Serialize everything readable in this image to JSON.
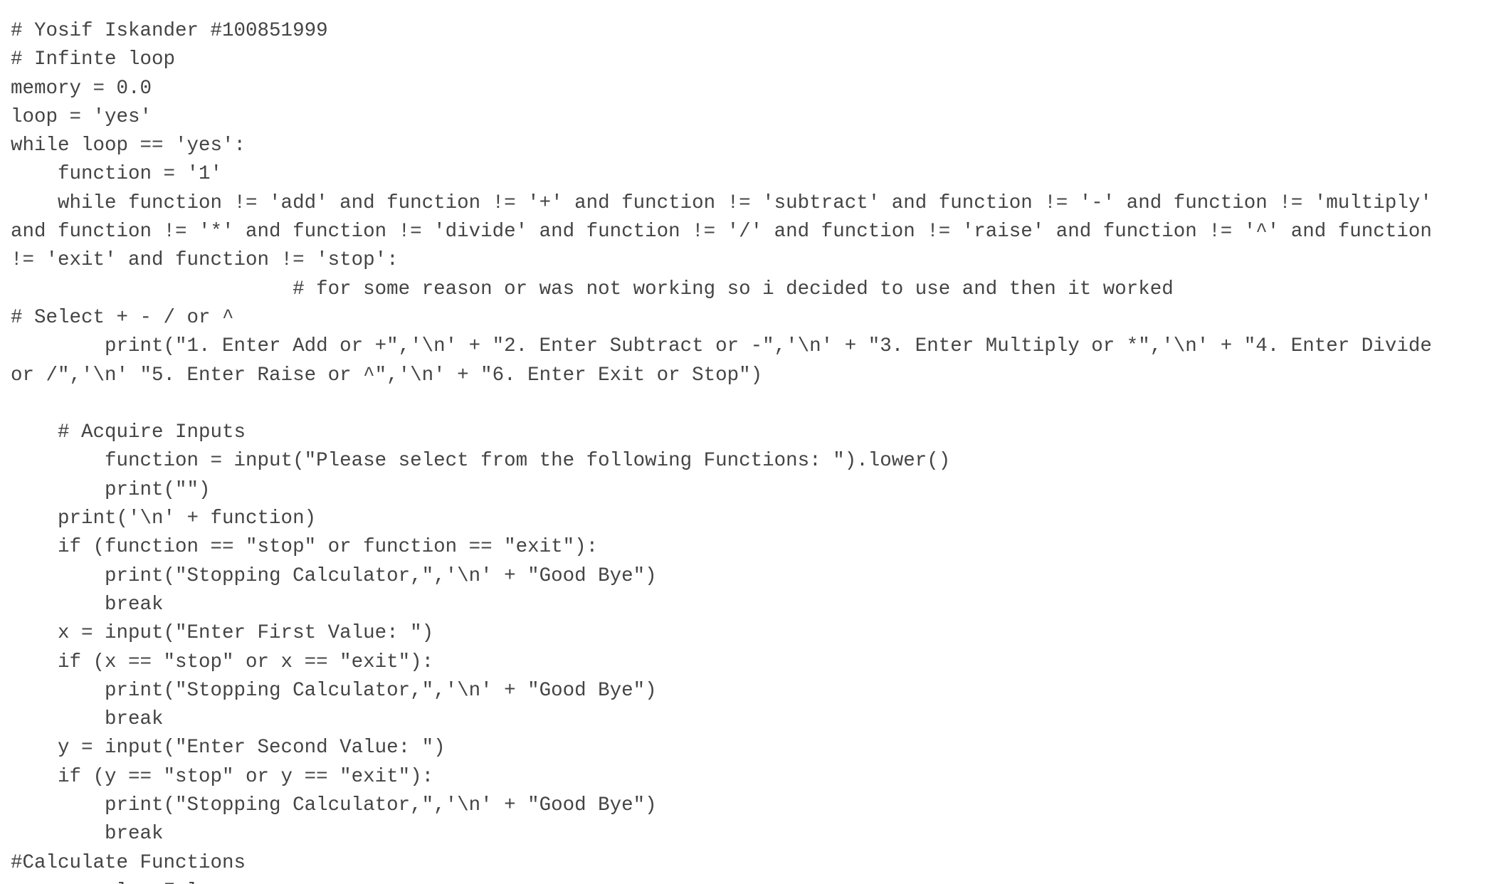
{
  "document": {
    "lines": [
      {
        "name": "comment-author",
        "text": "# Yosif Iskander #100851999"
      },
      {
        "name": "comment-infinite-loop",
        "text": "# Infinte loop"
      },
      {
        "name": "code-memory-init",
        "text": "memory = 0.0"
      },
      {
        "name": "code-loop-init",
        "text": "loop = 'yes'"
      },
      {
        "name": "code-while-loop",
        "text": "while loop == 'yes':"
      },
      {
        "name": "code-function-init",
        "text": "    function = '1'"
      },
      {
        "name": "code-while-function",
        "text": "    while function != 'add' and function != '+' and function != 'subtract' and function != '-' and function != 'multiply'"
      },
      {
        "name": "code-while-function-cont-1",
        "text": "and function != '*' and function != 'divide' and function != '/' and function != 'raise' and function != '^' and function"
      },
      {
        "name": "code-while-function-cont-2",
        "text": "!= 'exit' and function != 'stop':"
      },
      {
        "name": "comment-reason",
        "text": "                        # for some reason or was not working so i decided to use and then it worked"
      },
      {
        "name": "comment-select",
        "text": "# Select + - / or ^"
      },
      {
        "name": "code-print-menu",
        "text": "        print(\"1. Enter Add or +\",'\\n' + \"2. Enter Subtract or -\",'\\n' + \"3. Enter Multiply or *\",'\\n' + \"4. Enter Divide"
      },
      {
        "name": "code-print-menu-cont",
        "text": "or /\",'\\n' \"5. Enter Raise or ^\",'\\n' + \"6. Enter Exit or Stop\")"
      },
      {
        "name": "blank-line",
        "text": ""
      },
      {
        "name": "comment-acquire-inputs",
        "text": "    # Acquire Inputs"
      },
      {
        "name": "code-input-function",
        "text": "        function = input(\"Please select from the following Functions: \").lower()"
      },
      {
        "name": "code-print-empty",
        "text": "        print(\"\")"
      },
      {
        "name": "code-print-function",
        "text": "    print('\\n' + function)"
      },
      {
        "name": "code-if-function-stop",
        "text": "    if (function == \"stop\" or function == \"exit\"):"
      },
      {
        "name": "code-print-stopping-1",
        "text": "        print(\"Stopping Calculator,\",'\\n' + \"Good Bye\")"
      },
      {
        "name": "code-break-1",
        "text": "        break"
      },
      {
        "name": "code-input-x",
        "text": "    x = input(\"Enter First Value: \")"
      },
      {
        "name": "code-if-x-stop",
        "text": "    if (x == \"stop\" or x == \"exit\"):"
      },
      {
        "name": "code-print-stopping-2",
        "text": "        print(\"Stopping Calculator,\",'\\n' + \"Good Bye\")"
      },
      {
        "name": "code-break-2",
        "text": "        break"
      },
      {
        "name": "code-input-y",
        "text": "    y = input(\"Enter Second Value: \")"
      },
      {
        "name": "code-if-y-stop",
        "text": "    if (y == \"stop\" or y == \"exit\"):"
      },
      {
        "name": "code-print-stopping-3",
        "text": "        print(\"Stopping Calculator,\",'\\n' + \"Good Bye\")"
      },
      {
        "name": "code-break-3",
        "text": "        break"
      },
      {
        "name": "comment-calculate",
        "text": "#Calculate Functions"
      },
      {
        "name": "code-cancel-init",
        "text": "    cancel = False"
      }
    ]
  },
  "colors": {
    "background": "#ffffff",
    "text": "#444444"
  }
}
